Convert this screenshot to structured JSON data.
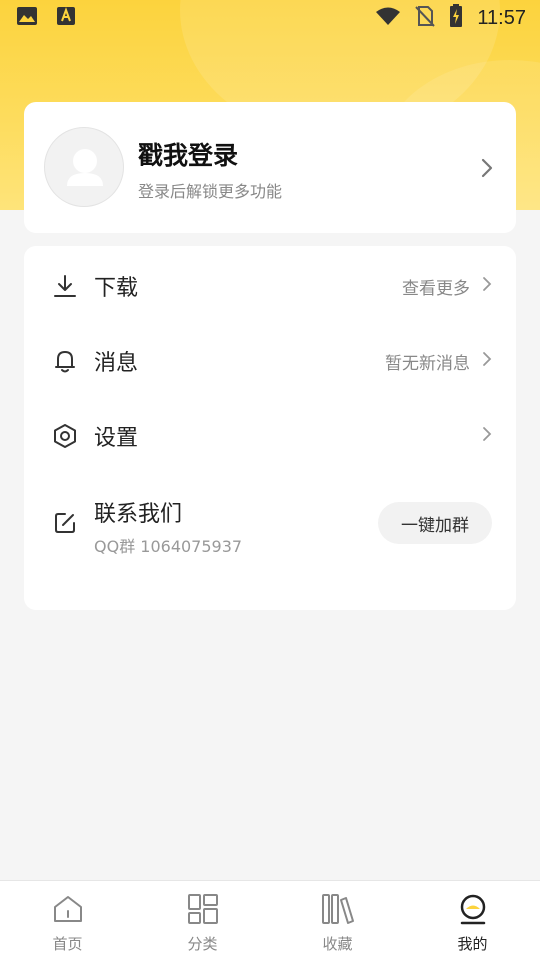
{
  "status_bar": {
    "time": "11:57",
    "icons": [
      "gallery-icon",
      "a-badge-icon",
      "wifi-icon",
      "no-sim-icon",
      "battery-charging-icon"
    ]
  },
  "colors": {
    "accent": "#fcd33d",
    "background": "#f5f5f5",
    "card": "#ffffff"
  },
  "login": {
    "title": "戳我登录",
    "subtitle": "登录后解锁更多功能"
  },
  "menu": {
    "download": {
      "label": "下载",
      "right_text": "查看更多"
    },
    "messages": {
      "label": "消息",
      "right_text": "暂无新消息"
    },
    "settings": {
      "label": "设置"
    },
    "contact": {
      "label": "联系我们",
      "sub": "QQ群 1064075937",
      "button": "一键加群"
    }
  },
  "bottom_nav": {
    "items": [
      {
        "label": "首页",
        "icon": "home-icon"
      },
      {
        "label": "分类",
        "icon": "category-icon"
      },
      {
        "label": "收藏",
        "icon": "bookshelf-icon"
      },
      {
        "label": "我的",
        "icon": "profile-icon",
        "active": true
      }
    ]
  }
}
